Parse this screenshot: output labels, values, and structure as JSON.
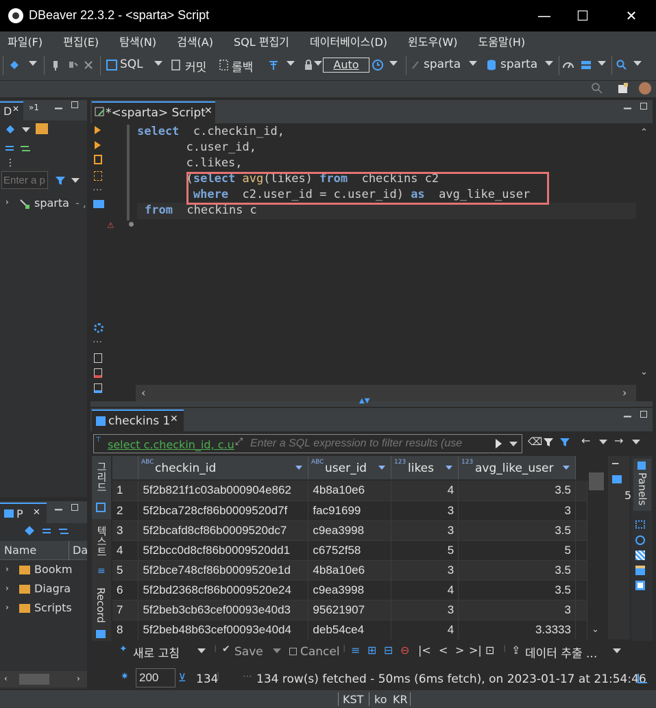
{
  "window": {
    "title": "DBeaver 22.3.2 - <sparta> Script",
    "minimize": "—",
    "maximize": "☐",
    "close": "✕"
  },
  "menu": [
    "파일(F)",
    "편집(E)",
    "탐색(N)",
    "검색(A)",
    "SQL 편집기",
    "데이터베이스(D)",
    "윈도우(W)",
    "도움말(H)"
  ],
  "toolbar": {
    "sql_label": "SQL",
    "commit_label": "커밋",
    "rollback_label": "롤백",
    "transaction_mode": "Auto",
    "datasource": "sparta",
    "schema": "sparta"
  },
  "navigator": {
    "tab_label": "D",
    "tab_extra": "»1",
    "filter_placeholder": "Enter a p",
    "tree_item": "sparta",
    "tree_item_suffix": "- ,"
  },
  "projects": {
    "tab_label": "P",
    "column_name": "Name",
    "column_da": "Da",
    "items": [
      "Bookm",
      "Diagra",
      "Scripts"
    ]
  },
  "editor": {
    "tab_label": "*<sparta> Script",
    "lines": [
      {
        "parts": [
          [
            "kw",
            "select"
          ],
          [
            "",
            "  c.checkin_id,"
          ]
        ]
      },
      {
        "parts": [
          [
            "",
            "       c.user_id,"
          ]
        ]
      },
      {
        "parts": [
          [
            "",
            "       c.likes,"
          ]
        ]
      },
      {
        "parts": [
          [
            "",
            "       ("
          ],
          [
            "kw",
            "select"
          ],
          [
            "",
            ""
          ],
          [
            "fn",
            " avg"
          ],
          [
            "",
            "(likes) "
          ],
          [
            "kw",
            "from"
          ],
          [
            "",
            ""
          ],
          [
            "",
            ""
          ],
          [
            "",
            ""
          ],
          [
            "",
            ""
          ],
          [
            "",
            ""
          ],
          [
            "",
            ""
          ],
          [
            "",
            "  checkins c2"
          ]
        ]
      },
      {
        "parts": [
          [
            "",
            "        "
          ],
          [
            "kw",
            "where"
          ],
          [
            "",
            "  c2.user_id = c.user_id) "
          ],
          [
            "kw",
            "as"
          ],
          [
            "",
            "  avg_like_user"
          ]
        ]
      },
      {
        "parts": [
          [
            "",
            ""
          ],
          [
            "kw",
            "from"
          ],
          [
            "",
            "  checkins c"
          ]
        ]
      }
    ]
  },
  "results": {
    "tab_label": "checkins 1",
    "filter_sql": "select c.checkin_id, c.u",
    "filter_placeholder": "Enter a SQL expression to filter results (use",
    "side_tabs": {
      "grid": "그리드",
      "text": "텍스트",
      "record": "Record"
    },
    "panels_label": "Panels",
    "panels_value": "5",
    "columns": [
      {
        "type": "ABC",
        "name": "checkin_id"
      },
      {
        "type": "ABC",
        "name": "user_id"
      },
      {
        "type": "123",
        "name": "likes"
      },
      {
        "type": "123",
        "name": "avg_like_user"
      }
    ],
    "rows": [
      [
        "1",
        "5f2b821f1c03ab000904e862",
        "4b8a10e6",
        "4",
        "3.5"
      ],
      [
        "2",
        "5f2bca728cf86b0009520d7f",
        "fac91699",
        "3",
        "3"
      ],
      [
        "3",
        "5f2bcafd8cf86b0009520dc7",
        "c9ea3998",
        "3",
        "3.5"
      ],
      [
        "4",
        "5f2bcc0d8cf86b0009520dd1",
        "c6752f58",
        "5",
        "5"
      ],
      [
        "5",
        "5f2bce748cf86b0009520e1d",
        "4b8a10e6",
        "3",
        "3.5"
      ],
      [
        "6",
        "5f2bd2368cf86b0009520e24",
        "c9ea3998",
        "4",
        "3.5"
      ],
      [
        "7",
        "5f2beb3cb63cef00093e40d3",
        "95621907",
        "3",
        "3"
      ],
      [
        "8",
        "5f2beb48b63cef00093e40d4",
        "deb54ce4",
        "4",
        "3.3333"
      ]
    ],
    "actions": {
      "refresh": "새로 고침",
      "save": "Save",
      "cancel": "Cancel",
      "export": "데이터 추출 ..."
    },
    "fetch_size": "200",
    "row_count": "134",
    "status_message": "134 row(s) fetched - 50ms (6ms fetch), on 2023-01-17 at 21:54:46"
  },
  "statusbar": {
    "timezone": "KST",
    "locale_lang": "ko",
    "locale_country": "KR"
  },
  "colors": {
    "keyword": "#7aa6da",
    "function": "#e5c07b",
    "highlight_box": "#e57373",
    "accent": "#4aa3ff"
  }
}
